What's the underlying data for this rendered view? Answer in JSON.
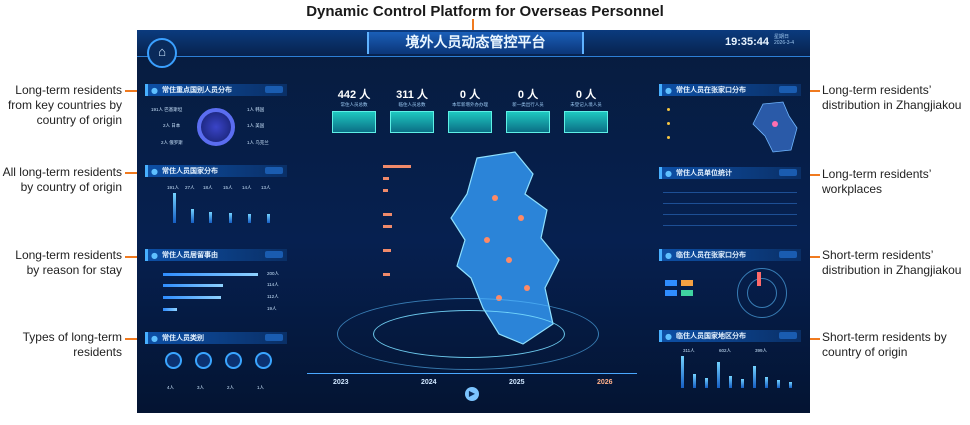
{
  "figure_title": "Dynamic Control Platform for Overseas Personnel",
  "annotations": {
    "left": [
      "Long-term residents from key countries by country of origin",
      "All long-term residents by country of origin",
      "Long-term residents by reason for stay",
      "Types of long-term residents"
    ],
    "right": [
      "Long-term residents’ distribution in Zhangjiakou",
      "Long-term residents’ workplaces",
      "Short-term residents’ distribution in Zhangjiakou",
      "Short-term residents by country of origin"
    ]
  },
  "dashboard": {
    "title": "境外人员动态管控平台",
    "time": "19:35:44",
    "weekday": "星期日",
    "date": "2026-3-4",
    "panels": {
      "key_countries": "常住重点国别人员分布",
      "all_countries": "常住人员国家分布",
      "reason": "常住人员居留事由",
      "types": "常住人员类别",
      "long_dist": "常住人员在张家口分布",
      "workplaces": "常住人员单位统计",
      "short_dist": "临住人员在张家口分布",
      "short_countries": "临住人员国家地区分布"
    },
    "stats": [
      {
        "value": "442 人",
        "caption": "常住人员总数"
      },
      {
        "value": "311 人",
        "caption": "临住人员总数"
      },
      {
        "value": "0 人",
        "caption": "本年新增外办办理"
      },
      {
        "value": "0 人",
        "caption": "新一类出行人员"
      },
      {
        "value": "0 人",
        "caption": "未登记入境人员"
      }
    ],
    "key_country_labels": [
      "191人 巴基斯坦",
      "2人 日本",
      "2人 俄罗斯",
      "1人 韩国",
      "1人 美国",
      "1人 乌克兰"
    ],
    "country_counts": [
      "191人",
      "27人",
      "18人",
      "15人",
      "14人",
      "13人"
    ],
    "reason_values": [
      "200人",
      "114人",
      "112人",
      "19人"
    ],
    "timeline_years": [
      "2023",
      "2024",
      "2025",
      "2026"
    ],
    "short_counts": [
      "311人",
      "602人",
      "399人"
    ],
    "type_counts": [
      "4人",
      "3人",
      "2人",
      "1人"
    ]
  }
}
